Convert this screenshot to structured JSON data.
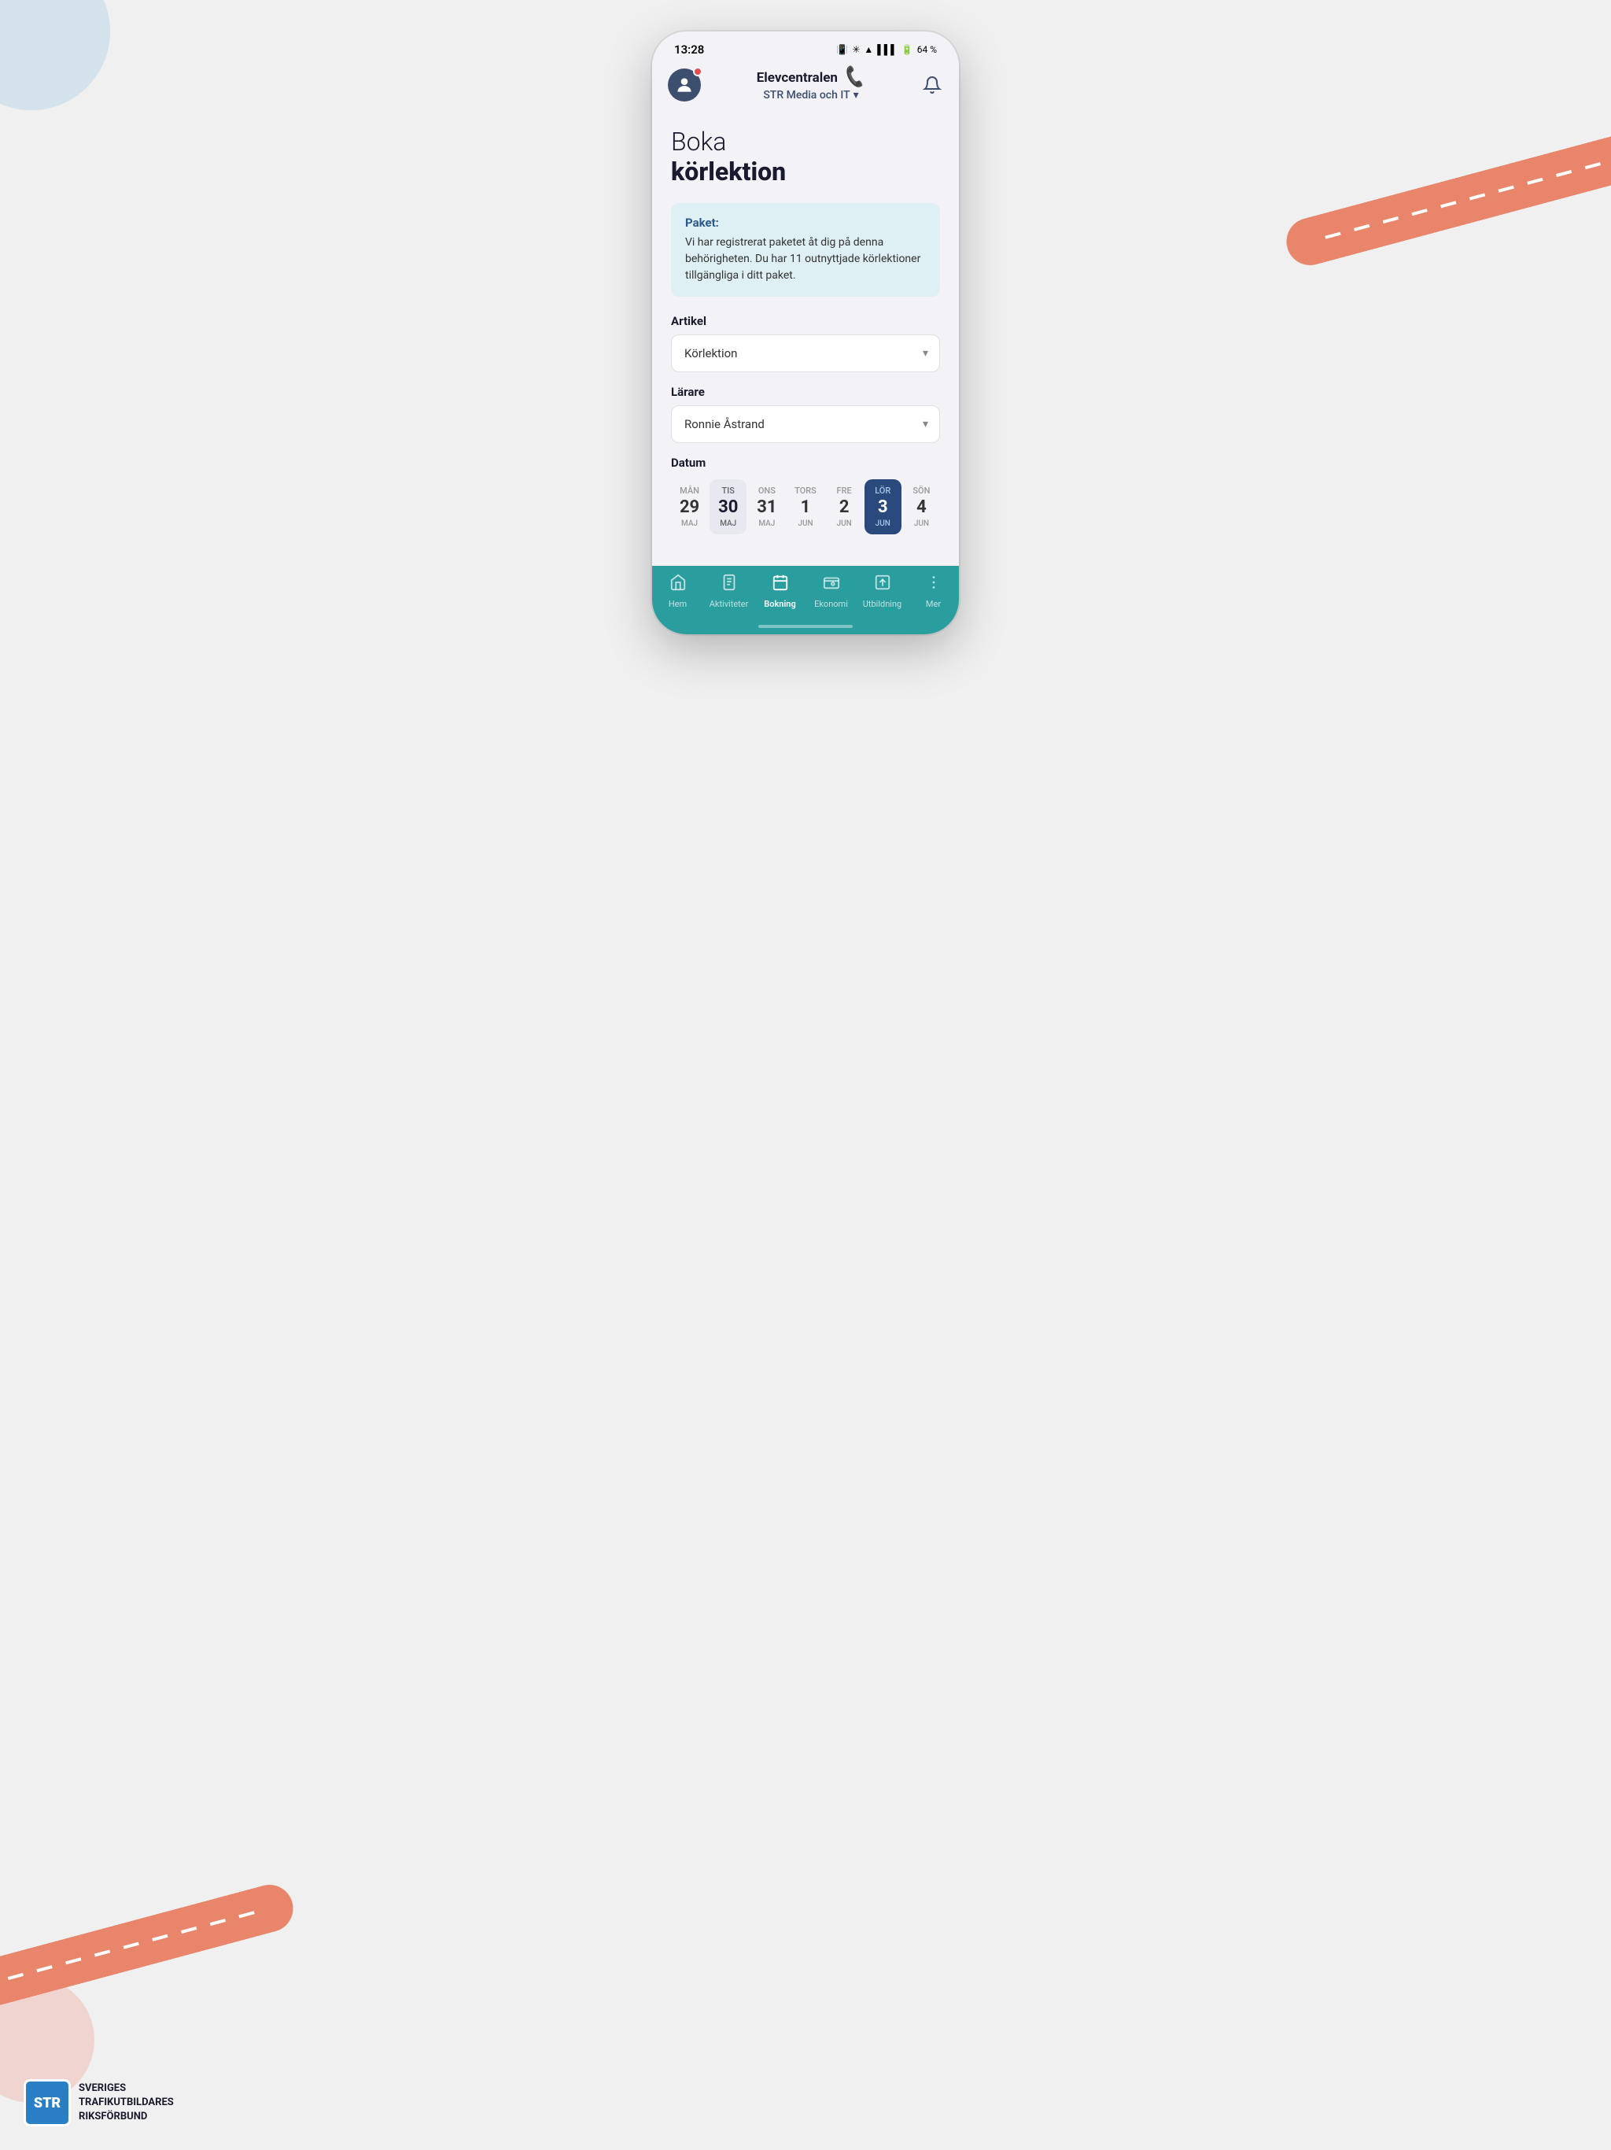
{
  "meta": {
    "title": "Boka körlektion",
    "status_time": "13:28",
    "status_battery": "64 %"
  },
  "header": {
    "brand_name": "Elevcentralen",
    "subtitle": "STR Media och IT",
    "subtitle_arrow": "▾"
  },
  "page": {
    "title_light": "Boka",
    "title_bold": "körlektion"
  },
  "info_box": {
    "title": "Paket:",
    "text": "Vi har registrerat paketet åt dig på denna behörigheten. Du har 11 outnyttjade körlektioner tillgängliga i ditt paket."
  },
  "form": {
    "artikel_label": "Artikel",
    "artikel_value": "Körlektion",
    "larare_label": "Lärare",
    "larare_value": "Ronnie Åstrand",
    "datum_label": "Datum"
  },
  "dates": [
    {
      "day": "MÅN",
      "number": "29",
      "month": "MAJ",
      "state": "normal"
    },
    {
      "day": "TIS",
      "number": "30",
      "month": "MAJ",
      "state": "highlighted"
    },
    {
      "day": "ONS",
      "number": "31",
      "month": "MAJ",
      "state": "normal"
    },
    {
      "day": "TORS",
      "number": "1",
      "month": "JUN",
      "state": "normal"
    },
    {
      "day": "FRE",
      "number": "2",
      "month": "JUN",
      "state": "normal"
    },
    {
      "day": "LÖR",
      "number": "3",
      "month": "JUN",
      "state": "selected"
    },
    {
      "day": "SÖN",
      "number": "4",
      "month": "JUN",
      "state": "normal"
    }
  ],
  "bottom_nav": [
    {
      "id": "hem",
      "label": "Hem",
      "icon": "⌂",
      "active": false
    },
    {
      "id": "aktiviteter",
      "label": "Aktiviteter",
      "icon": "📋",
      "active": false
    },
    {
      "id": "bokning",
      "label": "Bokning",
      "icon": "📅",
      "active": true
    },
    {
      "id": "ekonomi",
      "label": "Ekonomi",
      "icon": "💳",
      "active": false
    },
    {
      "id": "utbildning",
      "label": "Utbildning",
      "icon": "📊",
      "active": false
    },
    {
      "id": "mer",
      "label": "Mer",
      "icon": "⋮",
      "active": false
    }
  ],
  "str_logo": {
    "abbr": "STR",
    "line1": "SVERIGES",
    "line2": "TRAFIKUTBILDARES",
    "line3": "RIKSFÖRBUND"
  }
}
